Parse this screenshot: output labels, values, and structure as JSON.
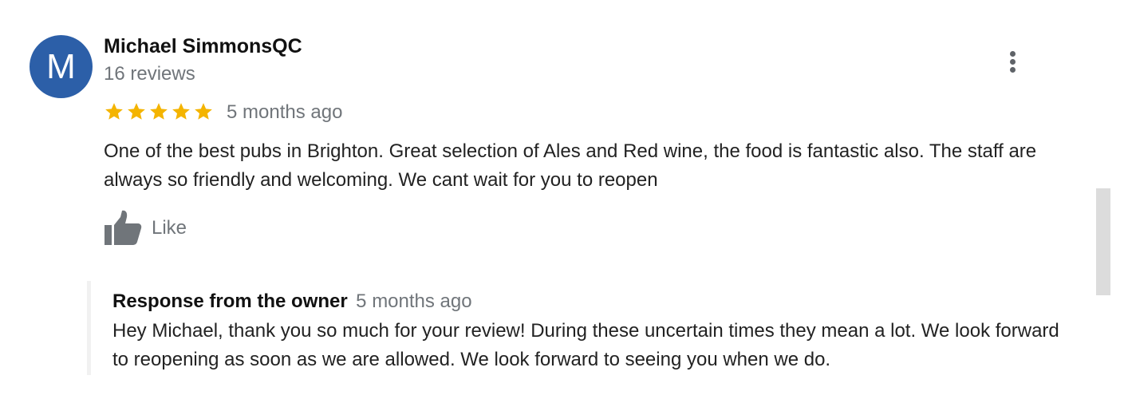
{
  "review": {
    "avatar_letter": "M",
    "author_name": "Michael SimmonsQC",
    "review_count": "16 reviews",
    "rating": 5,
    "max_rating": 5,
    "star_color": "#f4b400",
    "date": "5 months ago",
    "text": "One of the best pubs in Brighton. Great selection of Ales and Red wine, the food is fantastic also. The staff are always so friendly and welcoming. We cant wait for you to reopen",
    "like_label": "Like",
    "more_icon": "more-vert-icon",
    "like_icon": "thumbs-up-icon"
  },
  "owner_response": {
    "title": "Response from the owner",
    "date": "5 months ago",
    "text": "Hey Michael, thank you so much for your review! During these uncertain times they mean a lot. We look forward to reopening as soon as we are allowed. We look forward to seeing you when we do."
  },
  "colors": {
    "avatar_bg": "#2c5fa8",
    "secondary_text": "#70757a",
    "icon_gray": "#5f6368"
  }
}
